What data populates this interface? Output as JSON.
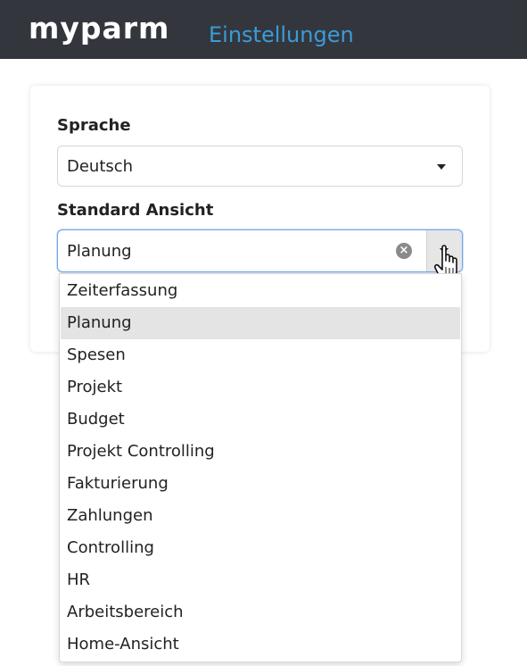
{
  "header": {
    "logo_text": "myparm",
    "page_title": "Einstellungen"
  },
  "language": {
    "label": "Sprache",
    "value": "Deutsch"
  },
  "default_view": {
    "label": "Standard Ansicht",
    "value": "Planung",
    "options": [
      "Zeiterfassung",
      "Planung",
      "Spesen",
      "Projekt",
      "Budget",
      "Projekt Controlling",
      "Fakturierung",
      "Zahlungen",
      "Controlling",
      "HR",
      "Arbeitsbereich",
      "Home-Ansicht"
    ],
    "selected_index": 1
  },
  "icons": {
    "clear": "clear-icon",
    "toggle": "chevron-down-icon",
    "cursor": "hand-cursor-icon"
  },
  "colors": {
    "topbar": "#33373d",
    "title": "#3b9bd8",
    "focus_border": "#6ea8e8",
    "selected_option": "#e4e4e4"
  }
}
